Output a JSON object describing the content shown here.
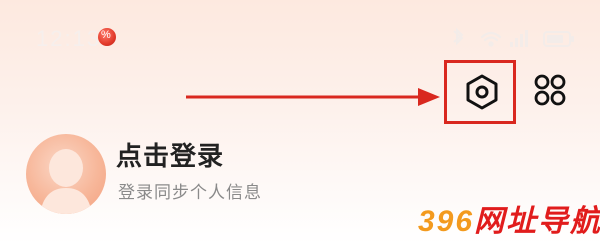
{
  "status_bar": {
    "time": "12:13",
    "app_badge": "%",
    "battery_percent": 80
  },
  "header": {
    "settings_icon": "settings-hexagon-icon",
    "grid_icon": "grid-apps-icon",
    "highlight_color": "#d9281f",
    "arrow_color": "#d9281f"
  },
  "profile": {
    "avatar_icon": "default-avatar-icon",
    "login_title": "点击登录",
    "login_subtitle": "登录同步个人信息"
  },
  "watermark": {
    "number": "396",
    "text": "网址导航"
  }
}
